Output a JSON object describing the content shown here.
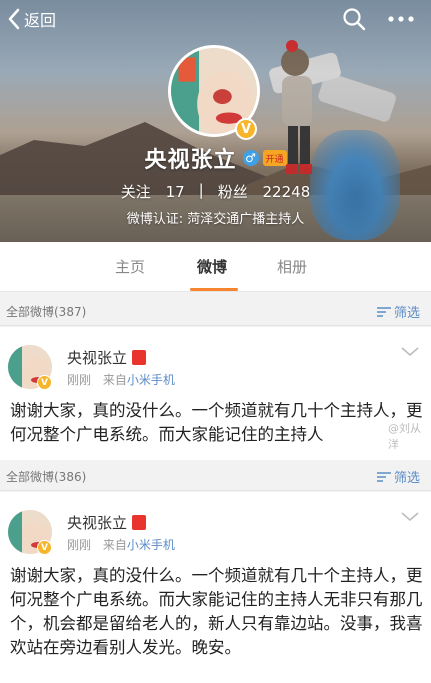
{
  "topbar": {
    "back_label": "返回",
    "icons": [
      "chevron-left-icon",
      "search-icon",
      "more-icon"
    ]
  },
  "profile": {
    "name": "央视张立",
    "member_badge": "开通",
    "following_label": "关注",
    "following_count": "17",
    "stat_separator": "|",
    "fans_label": "粉丝",
    "fans_count": "22248",
    "verification": "微博认证: 菏泽交通广播主持人",
    "verified_mark": "V",
    "gender_mark": "♂"
  },
  "tabs": [
    {
      "label": "主页",
      "active": false
    },
    {
      "label": "微博",
      "active": true
    },
    {
      "label": "相册",
      "active": false
    }
  ],
  "feed": [
    {
      "count_label": "全部微博(387)",
      "filter_label": "筛选",
      "author": "央视张立",
      "time": "刚刚",
      "source_prefix": "来自",
      "source": "小米手机",
      "text": "谢谢大家，真的没什么。一个频道就有几十个主持人，更何况整个广电系统。而大家能记住的主持人"
    },
    {
      "count_label": "全部微博(386)",
      "filter_label": "筛选",
      "author": "央视张立",
      "time": "刚刚",
      "source_prefix": "来自",
      "source": "小米手机",
      "text": "谢谢大家，真的没什么。一个频道就有几十个主持人，更何况整个广电系统。而大家能记住的主持人无非只有那几个，机会都是留给老人的，新人只有靠边站。没事，我喜欢站在旁边看别人发光。晚安。"
    }
  ],
  "watermark": "@刘从洋",
  "colors": {
    "accent_orange": "#f7832e",
    "link_blue": "#5b8cc8",
    "verified_gold": "#f6b52a"
  }
}
